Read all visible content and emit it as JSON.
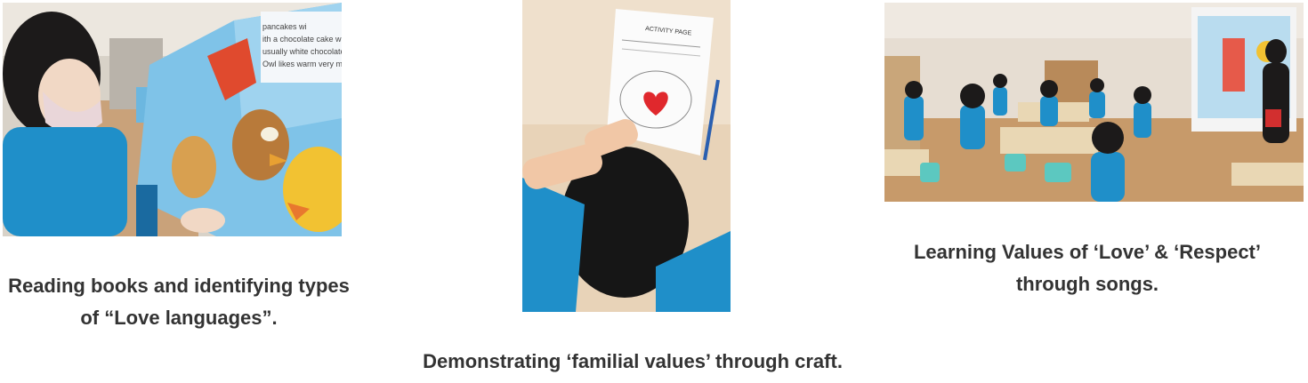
{
  "photos": [
    {
      "id": "reading",
      "caption_lines": [
        "Reading books and identifying types",
        "of “Love languages”."
      ],
      "visible_text": [
        "pancakes wi",
        "ith a chocolate cake w",
        "usually white chocolate",
        "Owl likes warm very muc"
      ]
    },
    {
      "id": "craft",
      "caption_lines": [
        "Demonstrating ‘familial values’ through craft."
      ],
      "visible_text": [
        "ACTIVITY PAGE"
      ]
    },
    {
      "id": "songs",
      "caption_lines": [
        "Learning Values of ‘Love’ & ‘Respect’",
        "through songs."
      ],
      "visible_text": []
    }
  ],
  "colors": {
    "caption_text": "#333333",
    "uniform_blue": "#1f8fc9",
    "heart_red": "#e0282d"
  }
}
